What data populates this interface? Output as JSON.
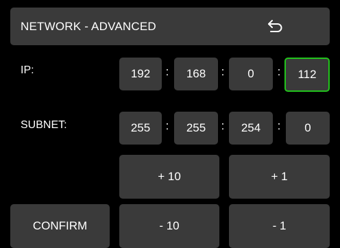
{
  "header": {
    "title": "NETWORK - ADVANCED",
    "back_icon": "back-arrow-icon"
  },
  "ip": {
    "label": "IP:",
    "octets": [
      "192",
      "168",
      "0",
      "112"
    ],
    "separator": ":",
    "selected_index": 3
  },
  "subnet": {
    "label": "SUBNET:",
    "octets": [
      "255",
      "255",
      "254",
      "0"
    ],
    "separator": ":"
  },
  "buttons": {
    "plus10": "+ 10",
    "plus1": "+ 1",
    "minus10": "- 10",
    "minus1": "- 1",
    "confirm": "CONFIRM"
  },
  "colors": {
    "background": "#000000",
    "panel": "#3a3a3a",
    "selected_border": "#22c41c",
    "text": "#ffffff"
  }
}
